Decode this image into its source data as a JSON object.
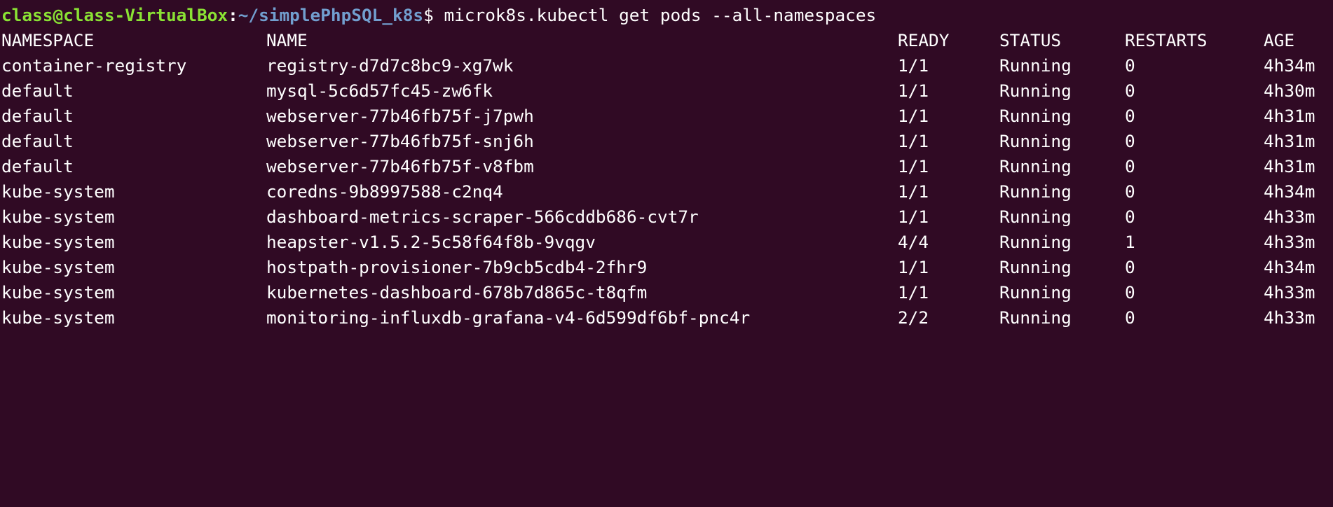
{
  "prompt": {
    "user_host": "class@class-VirtualBox",
    "colon": ":",
    "path": "~/simplePhpSQL_k8s",
    "dollar": "$ ",
    "command": "microk8s.kubectl get pods --all-namespaces"
  },
  "table": {
    "headers": {
      "namespace": "NAMESPACE",
      "name": "NAME",
      "ready": "READY",
      "status": "STATUS",
      "restarts": "RESTARTS",
      "age": "AGE"
    },
    "rows": [
      {
        "namespace": "container-registry",
        "name": "registry-d7d7c8bc9-xg7wk",
        "ready": "1/1",
        "status": "Running",
        "restarts": "0",
        "age": "4h34m"
      },
      {
        "namespace": "default",
        "name": "mysql-5c6d57fc45-zw6fk",
        "ready": "1/1",
        "status": "Running",
        "restarts": "0",
        "age": "4h30m"
      },
      {
        "namespace": "default",
        "name": "webserver-77b46fb75f-j7pwh",
        "ready": "1/1",
        "status": "Running",
        "restarts": "0",
        "age": "4h31m"
      },
      {
        "namespace": "default",
        "name": "webserver-77b46fb75f-snj6h",
        "ready": "1/1",
        "status": "Running",
        "restarts": "0",
        "age": "4h31m"
      },
      {
        "namespace": "default",
        "name": "webserver-77b46fb75f-v8fbm",
        "ready": "1/1",
        "status": "Running",
        "restarts": "0",
        "age": "4h31m"
      },
      {
        "namespace": "kube-system",
        "name": "coredns-9b8997588-c2nq4",
        "ready": "1/1",
        "status": "Running",
        "restarts": "0",
        "age": "4h34m"
      },
      {
        "namespace": "kube-system",
        "name": "dashboard-metrics-scraper-566cddb686-cvt7r",
        "ready": "1/1",
        "status": "Running",
        "restarts": "0",
        "age": "4h33m"
      },
      {
        "namespace": "kube-system",
        "name": "heapster-v1.5.2-5c58f64f8b-9vqgv",
        "ready": "4/4",
        "status": "Running",
        "restarts": "1",
        "age": "4h33m"
      },
      {
        "namespace": "kube-system",
        "name": "hostpath-provisioner-7b9cb5cdb4-2fhr9",
        "ready": "1/1",
        "status": "Running",
        "restarts": "0",
        "age": "4h34m"
      },
      {
        "namespace": "kube-system",
        "name": "kubernetes-dashboard-678b7d865c-t8qfm",
        "ready": "1/1",
        "status": "Running",
        "restarts": "0",
        "age": "4h33m"
      },
      {
        "namespace": "kube-system",
        "name": "monitoring-influxdb-grafana-v4-6d599df6bf-pnc4r",
        "ready": "2/2",
        "status": "Running",
        "restarts": "0",
        "age": "4h33m"
      }
    ]
  },
  "colors": {
    "background": "#300a24",
    "text": "#ffffff",
    "prompt_user": "#8ae234",
    "prompt_path": "#729fcf"
  }
}
